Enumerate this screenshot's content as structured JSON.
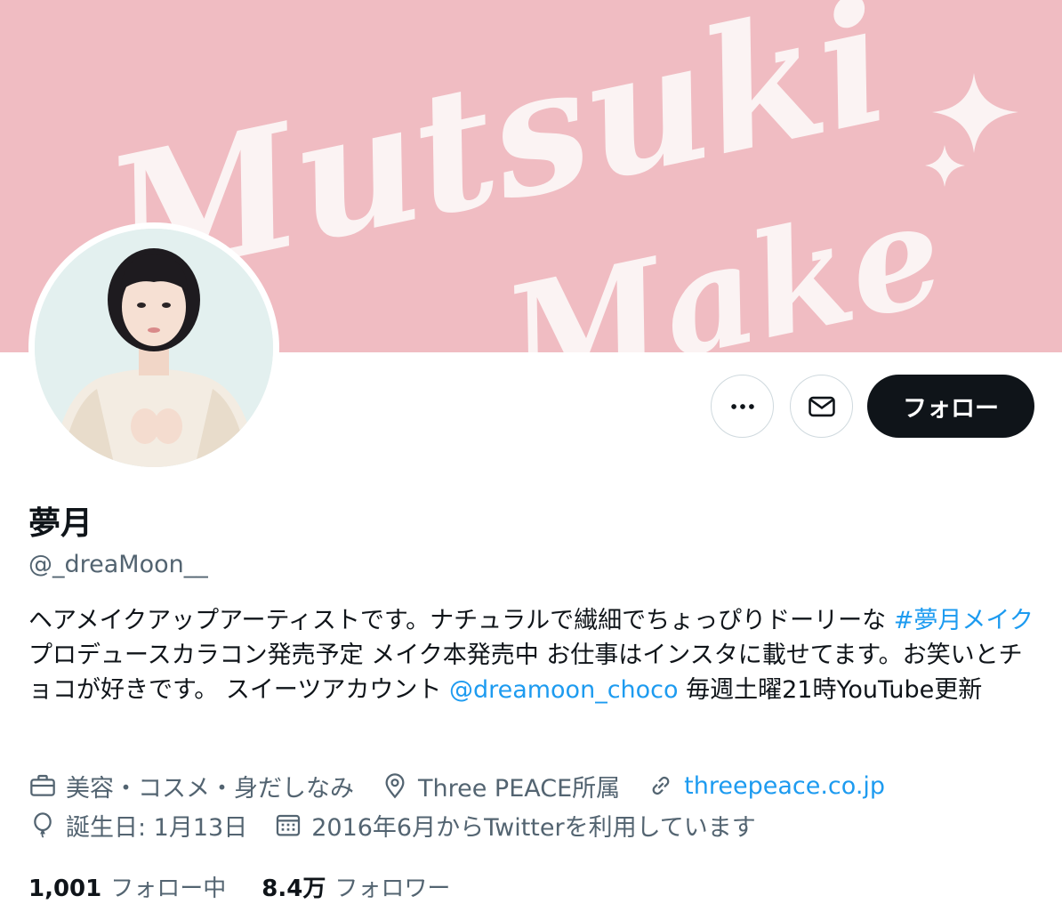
{
  "banner": {
    "text_line1": "Mutsuki",
    "text_line2": "Make",
    "bg_color": "#f0bcc2"
  },
  "profile": {
    "display_name": "夢月",
    "handle": "@_dreaMoon__",
    "bio": {
      "part1": "ヘアメイクアップアーティストです。ナチュラルで繊細でちょっぴりドーリーな ",
      "hashtag": "#夢月メイク",
      "part2": " プロデュースカラコン発売予定 メイク本発売中 お仕事はインスタに載せてます。お笑いとチョコが好きです。 スイーツアカウント ",
      "mention": "@dreamoon_choco",
      "part3": " 毎週土曜21時YouTube更新"
    },
    "category": "美容・コスメ・身だしなみ",
    "location": "Three PEACE所属",
    "website": "threepeace.co.jp",
    "birthday": "誕生日: 1月13日",
    "joined": "2016年6月からTwitterを利用しています"
  },
  "actions": {
    "more_icon": "more-icon",
    "message_icon": "envelope-icon",
    "follow_label": "フォロー"
  },
  "stats": {
    "following_count": "1,001",
    "following_label": "フォロー中",
    "followers_count": "8.4万",
    "followers_label": "フォロワー"
  },
  "colors": {
    "link": "#1d9bf0",
    "secondary_text": "#536471",
    "primary_button": "#0f1419"
  }
}
